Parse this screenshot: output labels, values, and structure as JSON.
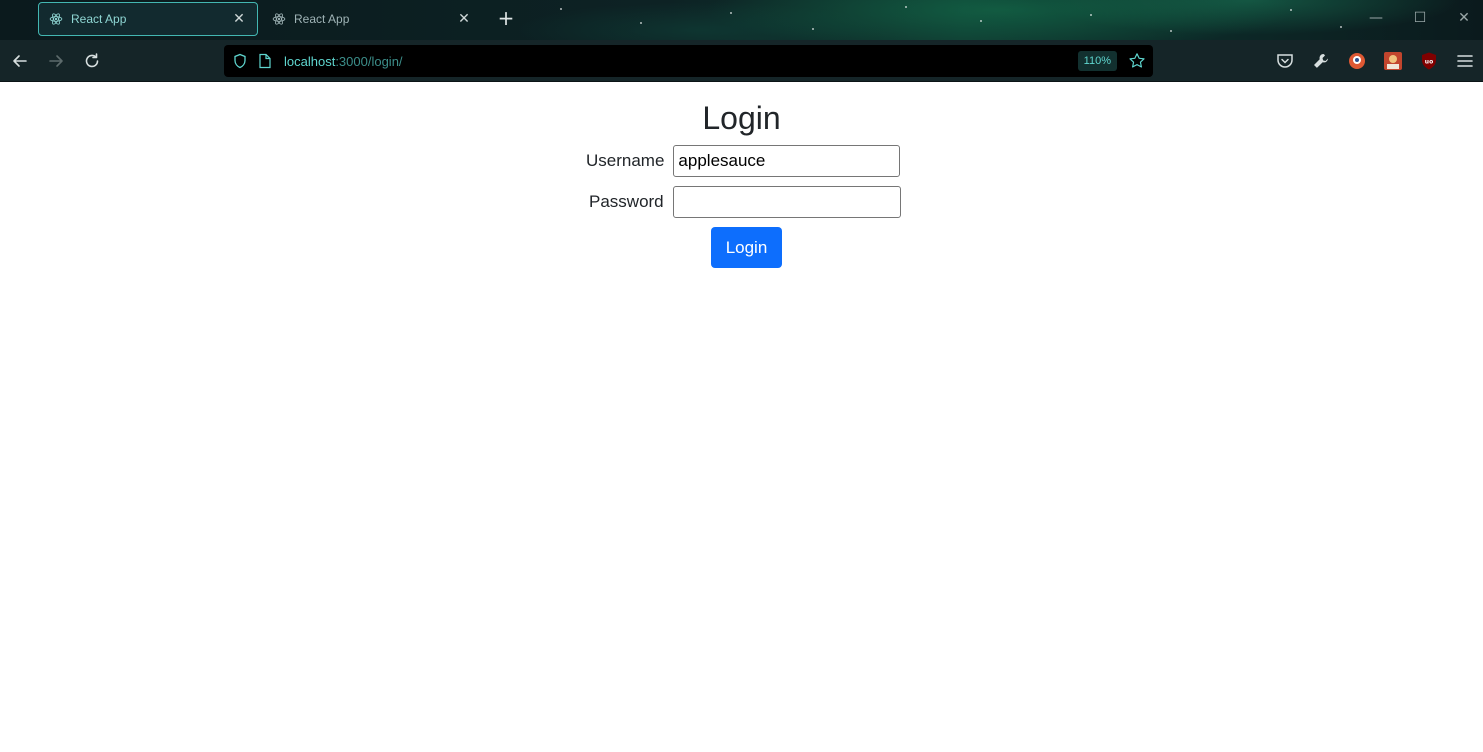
{
  "browser": {
    "tabs": [
      {
        "title": "React App",
        "active": true
      },
      {
        "title": "React App",
        "active": false
      }
    ],
    "url": {
      "host": "localhost",
      "path": ":3000/login/"
    },
    "zoom": "110%",
    "colors": {
      "accent": "#43b7b2",
      "url_host": "#5fd6cf",
      "url_path": "#3c8e8a"
    }
  },
  "page": {
    "title": "Login",
    "username": {
      "label": "Username",
      "value": "applesauce"
    },
    "password": {
      "label": "Password",
      "value": ""
    },
    "submit_label": "Login",
    "colors": {
      "button": "#0d6efd"
    }
  }
}
